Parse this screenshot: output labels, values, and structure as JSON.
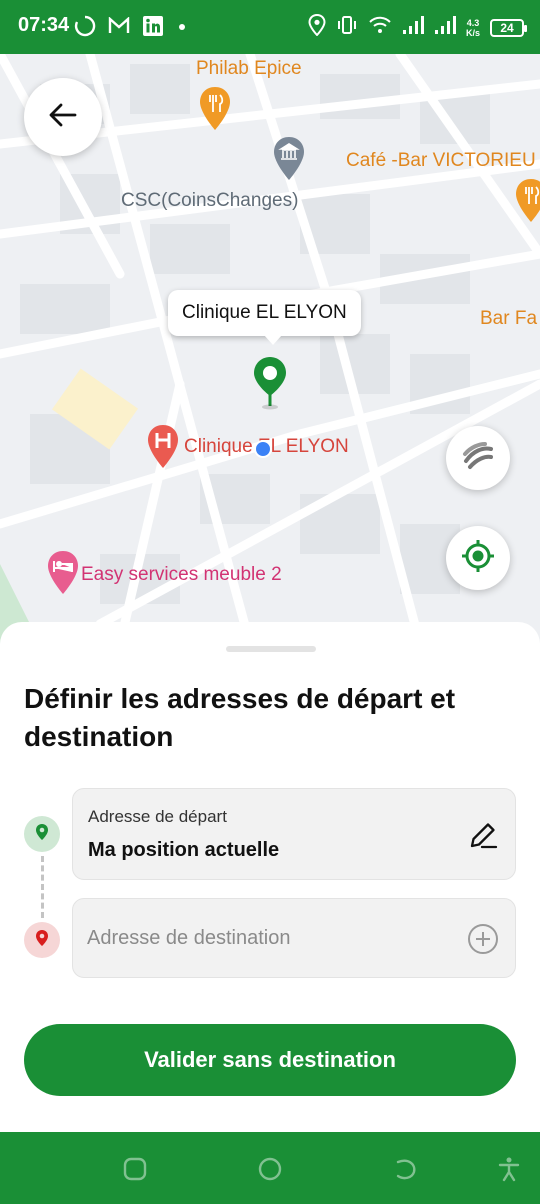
{
  "status_bar": {
    "time": "07:34",
    "net_speed_value": "4.3",
    "net_speed_unit": "K/s",
    "battery": "24",
    "icons": [
      "loading-circle-icon",
      "gmail-icon",
      "linkedin-icon",
      "dot-icon",
      "location-icon",
      "vibrate-icon",
      "wifi-icon",
      "signal-icon",
      "signal-icon",
      "battery-icon"
    ]
  },
  "map": {
    "pois": [
      {
        "label": "Philab Epice",
        "icon": "restaurant-pin-icon"
      },
      {
        "label": "Café -Bar VICTORIEU",
        "icon": "restaurant-pin-icon"
      },
      {
        "label": "CSC(CoinsChanges)",
        "icon": "bank-pin-icon"
      },
      {
        "label": "Bar Fa",
        "icon": "none"
      },
      {
        "label": "Clinique EL ELYON",
        "icon": "hospital-pin-icon"
      },
      {
        "label": "Easy services meuble 2",
        "icon": "hotel-pin-icon"
      }
    ],
    "callout": "Clinique EL ELYON",
    "colors": {
      "accent": "#1a8f36",
      "poi_orange": "#e0871f",
      "poi_gray": "#5f6b76",
      "poi_red": "#d6453c",
      "poi_pink": "#d23373"
    }
  },
  "sheet": {
    "title": "Définir les adresses de départ et destination",
    "start": {
      "label": "Adresse de départ",
      "value": "Ma position actuelle"
    },
    "destination": {
      "placeholder": "Adresse de destination",
      "value": ""
    },
    "cta_label": "Valider sans destination"
  }
}
